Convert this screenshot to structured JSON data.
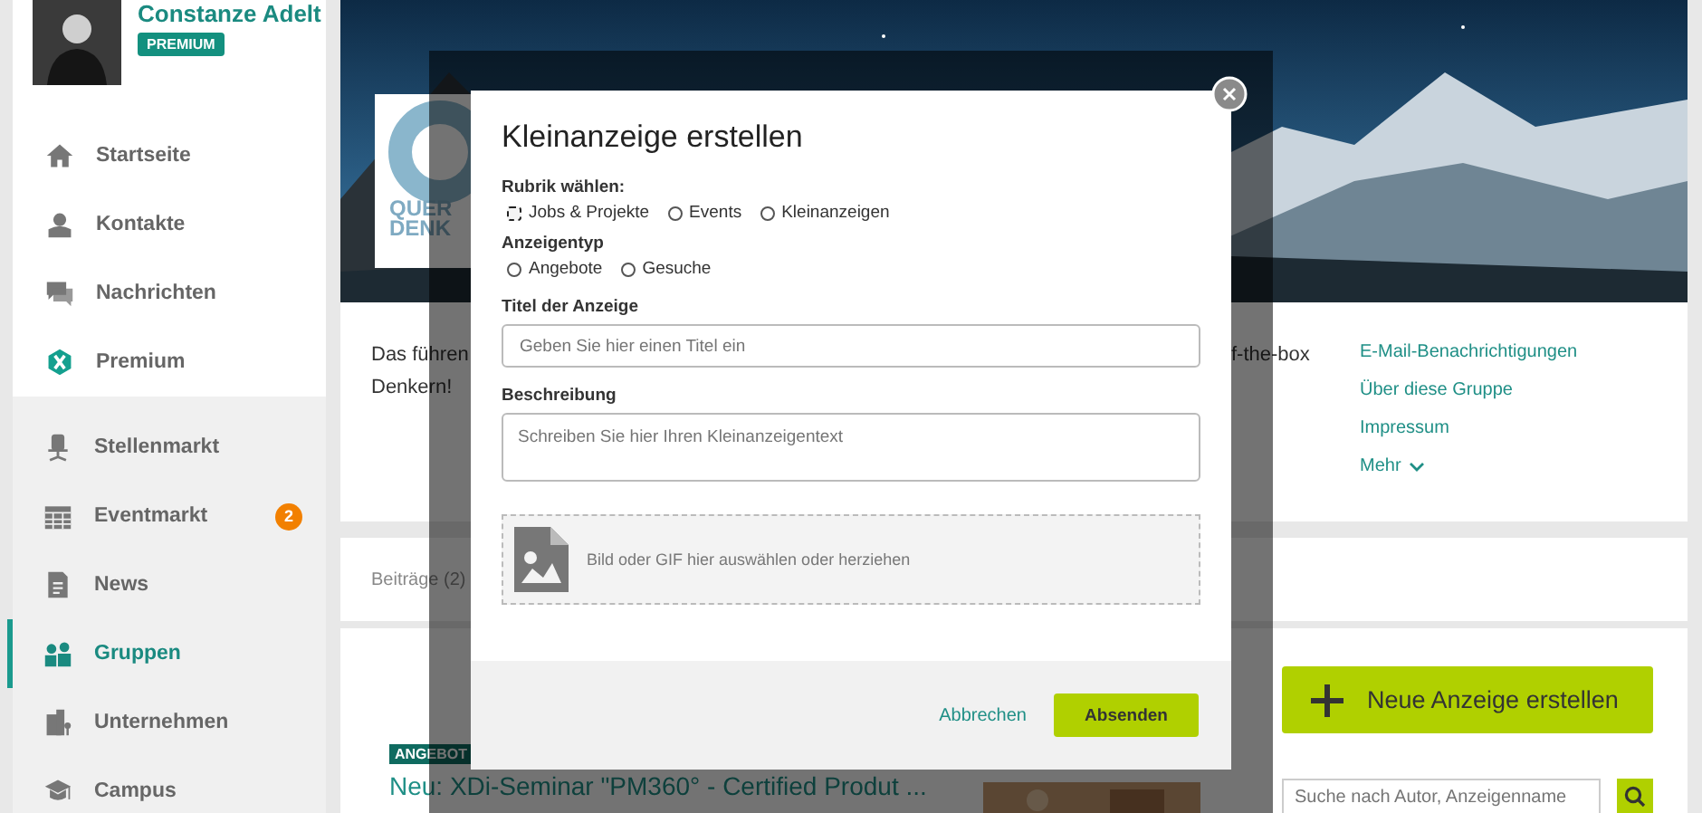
{
  "profile": {
    "name": "Constanze Adelt",
    "badge": "PREMIUM"
  },
  "nav_primary": [
    {
      "label": "Startseite",
      "selected": false
    },
    {
      "label": "Kontakte",
      "selected": false
    },
    {
      "label": "Nachrichten",
      "selected": false
    },
    {
      "label": "Premium",
      "selected": false
    }
  ],
  "nav_secondary": [
    {
      "label": "Stellenmarkt",
      "selected": false
    },
    {
      "label": "Eventmarkt",
      "selected": false,
      "count": "2"
    },
    {
      "label": "News",
      "selected": false
    },
    {
      "label": "Gruppen",
      "selected": true
    },
    {
      "label": "Unternehmen",
      "selected": false
    },
    {
      "label": "Campus",
      "selected": false
    }
  ],
  "group": {
    "logo_lines": [
      "QUER",
      "DENK"
    ],
    "description_lines": [
      "Das führen",
      "Denkern!"
    ],
    "description_tail": "f-the-box",
    "links": [
      "E-Mail-Benachrichtigungen",
      "Über diese Gruppe",
      "Impressum"
    ],
    "more": "Mehr"
  },
  "tab_label": "Beiträge (2)",
  "post": {
    "tag": "ANGEBOT",
    "title": "Neu: XDi-Seminar \"PM360° - Certified Produt ..."
  },
  "new_button": "Neue Anzeige erstellen",
  "search": {
    "placeholder": "Suche nach Autor, Anzeigenname"
  },
  "modal": {
    "title": "Kleinanzeige erstellen",
    "category_label": "Rubrik wählen:",
    "categories": [
      {
        "label": "Jobs & Projekte",
        "selected": false,
        "focused": true
      },
      {
        "label": "Events",
        "selected": false,
        "focused": false
      },
      {
        "label": "Kleinanzeigen",
        "selected": false,
        "focused": false
      }
    ],
    "type_label": "Anzeigentyp",
    "types": [
      {
        "label": "Angebote",
        "selected": false,
        "focused": false
      },
      {
        "label": "Gesuche",
        "selected": false,
        "focused": false
      }
    ],
    "title_label": "Titel der Anzeige",
    "title_placeholder": "Geben Sie hier einen Titel ein",
    "description_label": "Beschreibung",
    "description_placeholder": "Schreiben Sie hier Ihren Kleinanzeigentext",
    "upload_text": "Bild oder GIF hier auswählen oder herziehen",
    "cancel": "Abbrechen",
    "submit": "Absenden"
  }
}
